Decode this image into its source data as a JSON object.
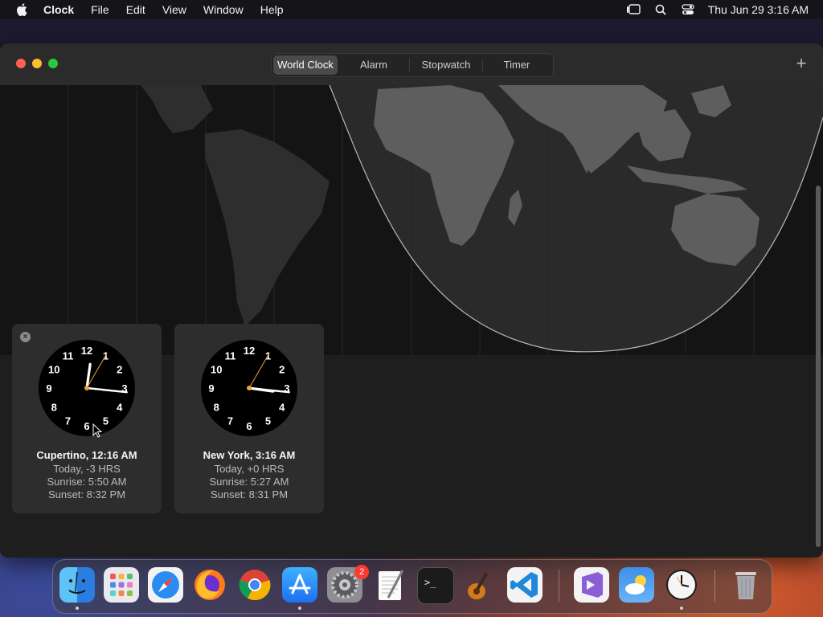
{
  "menubar": {
    "app": "Clock",
    "items": [
      "File",
      "Edit",
      "View",
      "Window",
      "Help"
    ],
    "datetime": "Thu Jun 29  3:16 AM"
  },
  "window": {
    "tabs": [
      {
        "label": "World Clock",
        "active": true
      },
      {
        "label": "Alarm",
        "active": false
      },
      {
        "label": "Stopwatch",
        "active": false
      },
      {
        "label": "Timer",
        "active": false
      }
    ],
    "add_label": "+"
  },
  "cards": [
    {
      "city_time": "Cupertino, 12:16 AM",
      "offset": "Today, -3 HRS",
      "sunrise": "Sunrise: 5:50 AM",
      "sunset": "Sunset: 8:32 PM",
      "hour": 0,
      "minute": 16,
      "second": 5,
      "removable": true
    },
    {
      "city_time": "New York, 3:16 AM",
      "offset": "Today, +0 HRS",
      "sunrise": "Sunrise: 5:27 AM",
      "sunset": "Sunset: 8:31 PM",
      "hour": 3,
      "minute": 16,
      "second": 5,
      "removable": false
    }
  ],
  "dial_numbers": [
    "12",
    "1",
    "2",
    "3",
    "4",
    "5",
    "6",
    "7",
    "8",
    "9",
    "10",
    "11"
  ],
  "dock": {
    "apps": [
      "finder-icon",
      "launchpad-icon",
      "safari-icon",
      "firefox-icon",
      "chrome-icon",
      "app-store-icon",
      "system-settings-icon",
      "textedit-icon",
      "terminal-icon",
      "garageband-icon",
      "vscode-icon",
      "visual-studio-icon",
      "weather-icon",
      "clock-icon",
      "trash-icon"
    ],
    "settings_badge": "2"
  },
  "colors": {
    "accent_hand": "#f0a040",
    "close": "#ff5f57",
    "minimize": "#febc2e",
    "zoom": "#28c840"
  }
}
